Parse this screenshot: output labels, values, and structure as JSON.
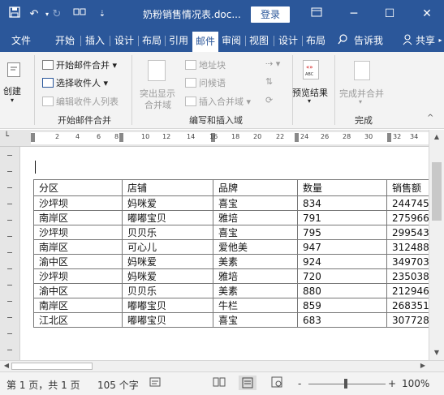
{
  "titlebar": {
    "doc_title": "奶粉销售情况表.doc...",
    "login": "登录"
  },
  "tabs": [
    "文件",
    "开始",
    "插入",
    "设计",
    "布局",
    "引用",
    "邮件",
    "审阅",
    "视图",
    "设计",
    "布局",
    "告诉我",
    "共享"
  ],
  "ribbon": {
    "create": "创建",
    "start_merge": "开始邮件合并",
    "select_recipients": "选择收件人",
    "edit_recipients": "编辑收件人列表",
    "group_start": "开始邮件合并",
    "highlight_line1": "突出显示",
    "highlight_line2": "合并域",
    "address_block": "地址块",
    "greeting_line": "问候语",
    "insert_field": "插入合并域",
    "group_write": "编写和插入域",
    "preview_results": "预览结果",
    "preview_abc": "ABC",
    "finish_merge": "完成并合并",
    "group_finish": "完成"
  },
  "ruler": {
    "numbers": [
      "2",
      "4",
      "6",
      "8",
      "10",
      "12",
      "14",
      "16",
      "18",
      "20",
      "22",
      "24",
      "26",
      "28",
      "30",
      "32",
      "34"
    ]
  },
  "table": {
    "headers": [
      "分区",
      "店铺",
      "品牌",
      "数量",
      "销售额"
    ],
    "rows": [
      [
        "沙坪坝",
        "妈咪爱",
        "喜宝",
        "834",
        "244745"
      ],
      [
        "南岸区",
        "嘟嘟宝贝",
        "雅培",
        "791",
        "275966"
      ],
      [
        "沙坪坝",
        "贝贝乐",
        "喜宝",
        "795",
        "299543"
      ],
      [
        "南岸区",
        "可心儿",
        "爱他美",
        "947",
        "312488"
      ],
      [
        "渝中区",
        "妈咪爱",
        "美素",
        "924",
        "349703"
      ],
      [
        "沙坪坝",
        "妈咪爱",
        "雅培",
        "720",
        "235038"
      ],
      [
        "渝中区",
        "贝贝乐",
        "美素",
        "880",
        "212946"
      ],
      [
        "南岸区",
        "嘟嘟宝贝",
        "牛栏",
        "859",
        "268351"
      ],
      [
        "江北区",
        "嘟嘟宝贝",
        "喜宝",
        "683",
        "307728"
      ]
    ]
  },
  "status": {
    "page_info": "第 1 页，共 1 页",
    "word_count": "105 个字",
    "zoom": "100%",
    "zoom_minus": "-",
    "zoom_plus": "+"
  },
  "colors": {
    "accent": "#2b579a",
    "ribbon_bg": "#f3f3f3"
  }
}
